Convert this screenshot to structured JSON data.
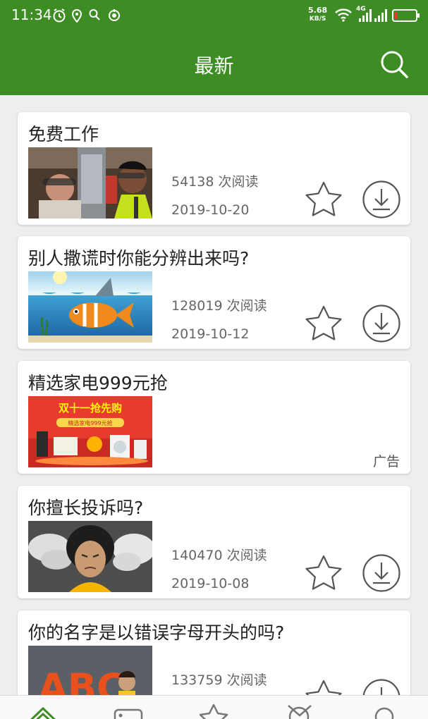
{
  "status_bar": {
    "time": "11:34",
    "net_speed": "5.68",
    "net_unit": "KB/S",
    "signal_label": "4G"
  },
  "header": {
    "title": "最新"
  },
  "articles": [
    {
      "title": "免费工作",
      "reads": "54138 次阅读",
      "date": "2019-10-20"
    },
    {
      "title": "别人撒谎时你能分辨出来吗?",
      "reads": "128019 次阅读",
      "date": "2019-10-12"
    },
    {
      "title": "你擅长投诉吗?",
      "reads": "140470 次阅读",
      "date": "2019-10-08"
    },
    {
      "title": "你的名字是以错误字母开头的吗?",
      "reads": "133759 次阅读",
      "date": ""
    }
  ],
  "ad": {
    "title": "精选家电999元抢",
    "label": "广告",
    "banner_headline": "双十一抢先购",
    "banner_subline": "精选家电999元抢"
  },
  "thumb_text": {
    "letters": "ABC"
  },
  "colors": {
    "primary_green": "#3d8d24",
    "card_bg": "#ffffff",
    "text_dark": "#222222",
    "text_meta": "#666666",
    "icon_gray": "#555555"
  },
  "icons": {
    "header_search": "search-icon",
    "card_favorite": "star-outline-icon",
    "card_download": "download-circle-icon",
    "tabs": [
      "home-icon",
      "video-icon",
      "star-icon",
      "discover-icon",
      "search-icon"
    ]
  }
}
